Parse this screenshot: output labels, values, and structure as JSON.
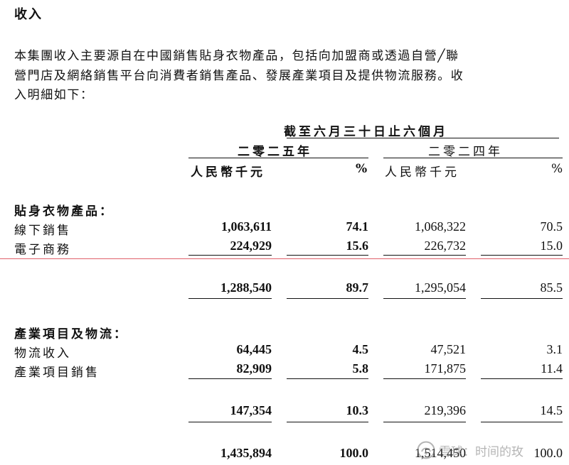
{
  "heading": "收入",
  "paragraph": {
    "line1": "本集團收入主要源自在中國銷售貼身衣物產品，包括向加盟商或透過自營╱聯",
    "line2": "營門店及網絡銷售平台向消費者銷售產品、發展產業項目及提供物流服務。收",
    "line3": "入明細如下："
  },
  "table_header": {
    "period": "截至六月三十日止六個月",
    "year_2025": "二零二五年",
    "year_2024": "二零二四年",
    "rmb": "人民幣千元",
    "pct": "%"
  },
  "sections": [
    {
      "title": "貼身衣物產品：",
      "rows": [
        {
          "label": "線下銷售",
          "v2025": "1,063,611",
          "p2025": "74.1",
          "v2024": "1,068,322",
          "p2024": "70.5"
        },
        {
          "label": "電子商務",
          "v2025": "224,929",
          "p2025": "15.6",
          "v2024": "226,732",
          "p2024": "15.0"
        }
      ],
      "subtotal": {
        "v2025": "1,288,540",
        "p2025": "89.7",
        "v2024": "1,295,054",
        "p2024": "85.5"
      }
    },
    {
      "title": "產業項目及物流：",
      "rows": [
        {
          "label": "物流收入",
          "v2025": "64,445",
          "p2025": "4.5",
          "v2024": "47,521",
          "p2024": "3.1"
        },
        {
          "label": "產業項目銷售",
          "v2025": "82,909",
          "p2025": "5.8",
          "v2024": "171,875",
          "p2024": "11.4"
        }
      ],
      "subtotal": {
        "v2025": "147,354",
        "p2025": "10.3",
        "v2024": "219,396",
        "p2024": "14.5"
      }
    }
  ],
  "total": {
    "v2025": "1,435,894",
    "p2025": "100.0",
    "v2024": "1,514,450",
    "p2024": "100.0"
  },
  "watermark": {
    "text": "雪球：时间的玫",
    "icon": "snowball-logo-icon"
  },
  "colors": {
    "text": "#111111",
    "highlight_line": "#e0606a",
    "watermark": "#7a7a7a"
  }
}
